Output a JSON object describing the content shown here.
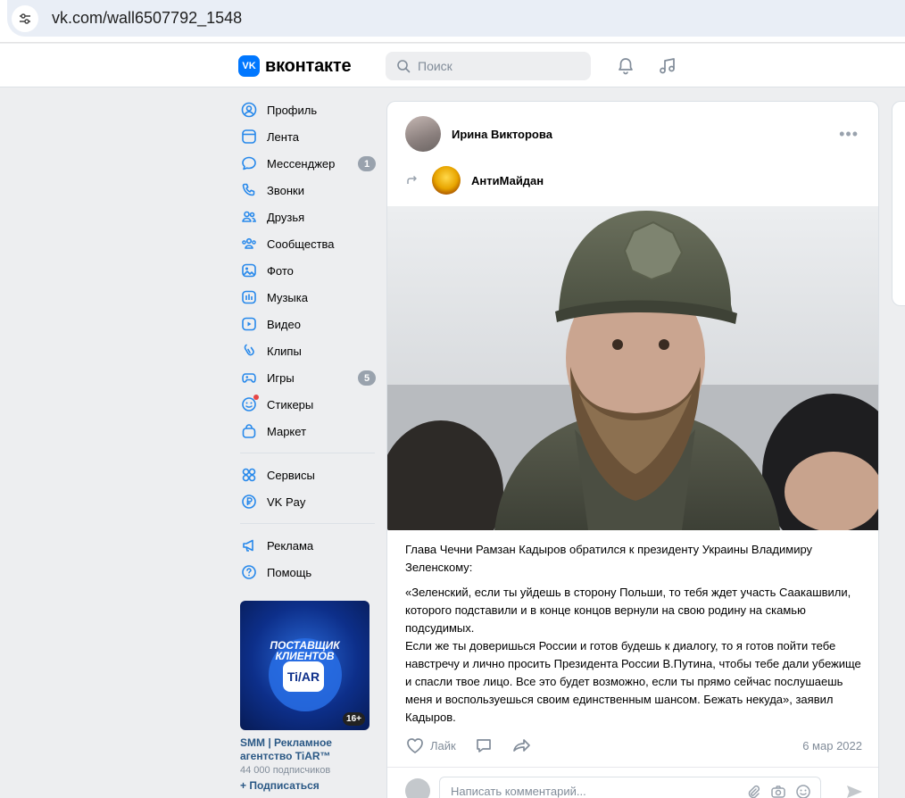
{
  "browser": {
    "url": "vk.com/wall6507792_1548"
  },
  "header": {
    "logo_text": "вконтакте",
    "logo_mark": "VK",
    "search_placeholder": "Поиск"
  },
  "sidebar": {
    "items": [
      {
        "label": "Профиль",
        "icon": "user-circle-icon"
      },
      {
        "label": "Лента",
        "icon": "feed-icon"
      },
      {
        "label": "Мессенджер",
        "icon": "chat-bubble-icon",
        "count": "1"
      },
      {
        "label": "Звонки",
        "icon": "phone-icon"
      },
      {
        "label": "Друзья",
        "icon": "friends-icon"
      },
      {
        "label": "Сообщества",
        "icon": "communities-icon"
      },
      {
        "label": "Фото",
        "icon": "photo-icon"
      },
      {
        "label": "Музыка",
        "icon": "music-icon"
      },
      {
        "label": "Видео",
        "icon": "video-icon"
      },
      {
        "label": "Клипы",
        "icon": "clips-icon"
      },
      {
        "label": "Игры",
        "icon": "gamepad-icon",
        "count": "5"
      },
      {
        "label": "Стикеры",
        "icon": "sticker-icon"
      },
      {
        "label": "Маркет",
        "icon": "market-bag-icon"
      }
    ],
    "services": [
      {
        "label": "Сервисы",
        "icon": "services-grid-icon"
      },
      {
        "label": "VK Pay",
        "icon": "ruble-icon"
      }
    ],
    "misc": [
      {
        "label": "Реклама",
        "icon": "megaphone-icon"
      },
      {
        "label": "Помощь",
        "icon": "help-icon"
      }
    ],
    "ad": {
      "image_title": "ПОСТАВЩИК КЛИЕНТОВ",
      "image_brand": "Ti/AR",
      "age": "16+",
      "name": "SMM | Рекламное агентство TiAR™",
      "subscribers": "44 000 подписчиков",
      "subscribe": "+ Подписаться"
    }
  },
  "post": {
    "author": "Ирина Викторова",
    "repost_group": "АнтиМайдан",
    "text_intro": "Глава Чечни Рамзан Кадыров обратился к президенту Украины Владимиру Зеленскому:",
    "text_quote_1": "«Зеленский, если ты уйдешь в сторону Польши, то тебя ждет участь Саакашвили, которого подставили и в конце концов вернули на свою родину на скамью подсудимых.",
    "text_quote_2": "Если же ты доверишься России и готов будешь к диалогу, то я готов пойти тебе навстречу и лично просить Президента России В.Путина, чтобы тебе дали убежище и спасли твое лицо. Все это будет возможно, если ты прямо сейчас послушаешь меня и воспользуешься своим единственным шансом. Бежать некуда», заявил Кадыров.",
    "like_label": "Лайк",
    "date": "6 мар 2022",
    "comment_placeholder": "Написать комментарий..."
  },
  "colors": {
    "accent": "#0077ff",
    "link": "#2a5885",
    "badge": "#99a2ad",
    "page_bg": "#edeef0"
  }
}
